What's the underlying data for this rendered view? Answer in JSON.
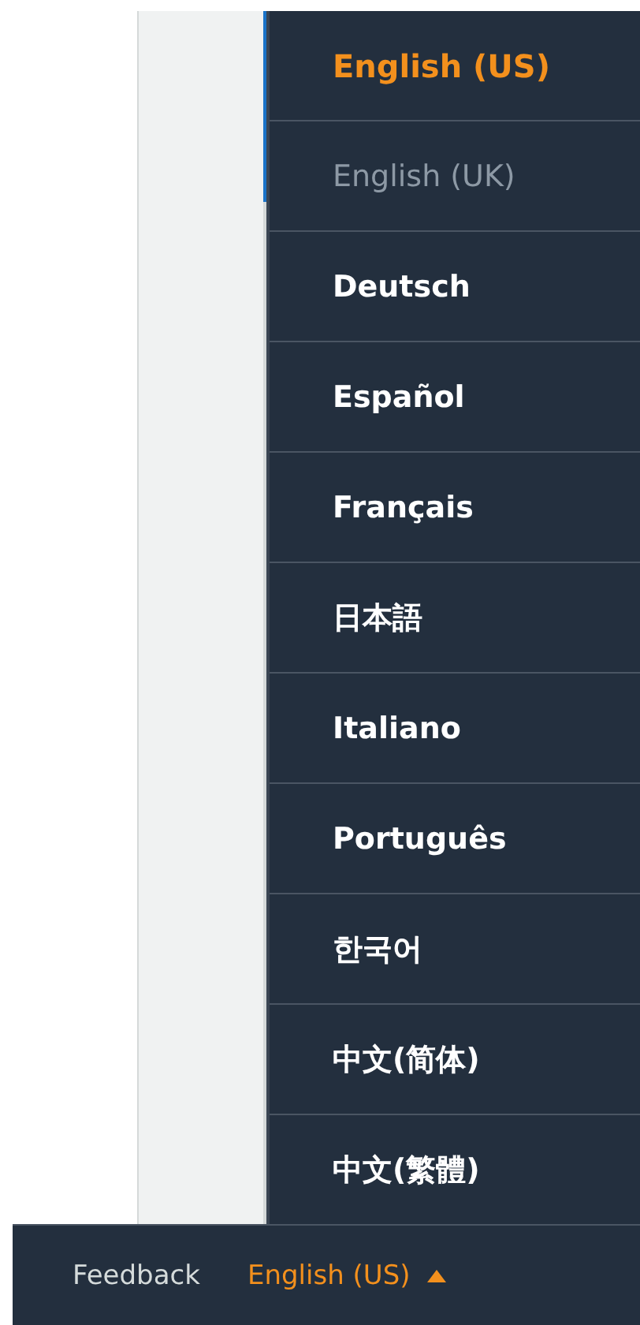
{
  "language_menu": {
    "expanded": true,
    "items": [
      {
        "label": "English (US)",
        "selected": true,
        "disabled": false
      },
      {
        "label": "English (UK)",
        "selected": false,
        "disabled": true
      },
      {
        "label": "Deutsch",
        "selected": false,
        "disabled": false
      },
      {
        "label": "Español",
        "selected": false,
        "disabled": false
      },
      {
        "label": "Français",
        "selected": false,
        "disabled": false
      },
      {
        "label": "日本語",
        "selected": false,
        "disabled": false
      },
      {
        "label": "Italiano",
        "selected": false,
        "disabled": false
      },
      {
        "label": "Português",
        "selected": false,
        "disabled": false
      },
      {
        "label": "한국어",
        "selected": false,
        "disabled": false
      },
      {
        "label": "中文(简体)",
        "selected": false,
        "disabled": false
      },
      {
        "label": "中文(繁體)",
        "selected": false,
        "disabled": false
      }
    ]
  },
  "footer": {
    "feedback": "Feedback",
    "language": "English (US)"
  }
}
